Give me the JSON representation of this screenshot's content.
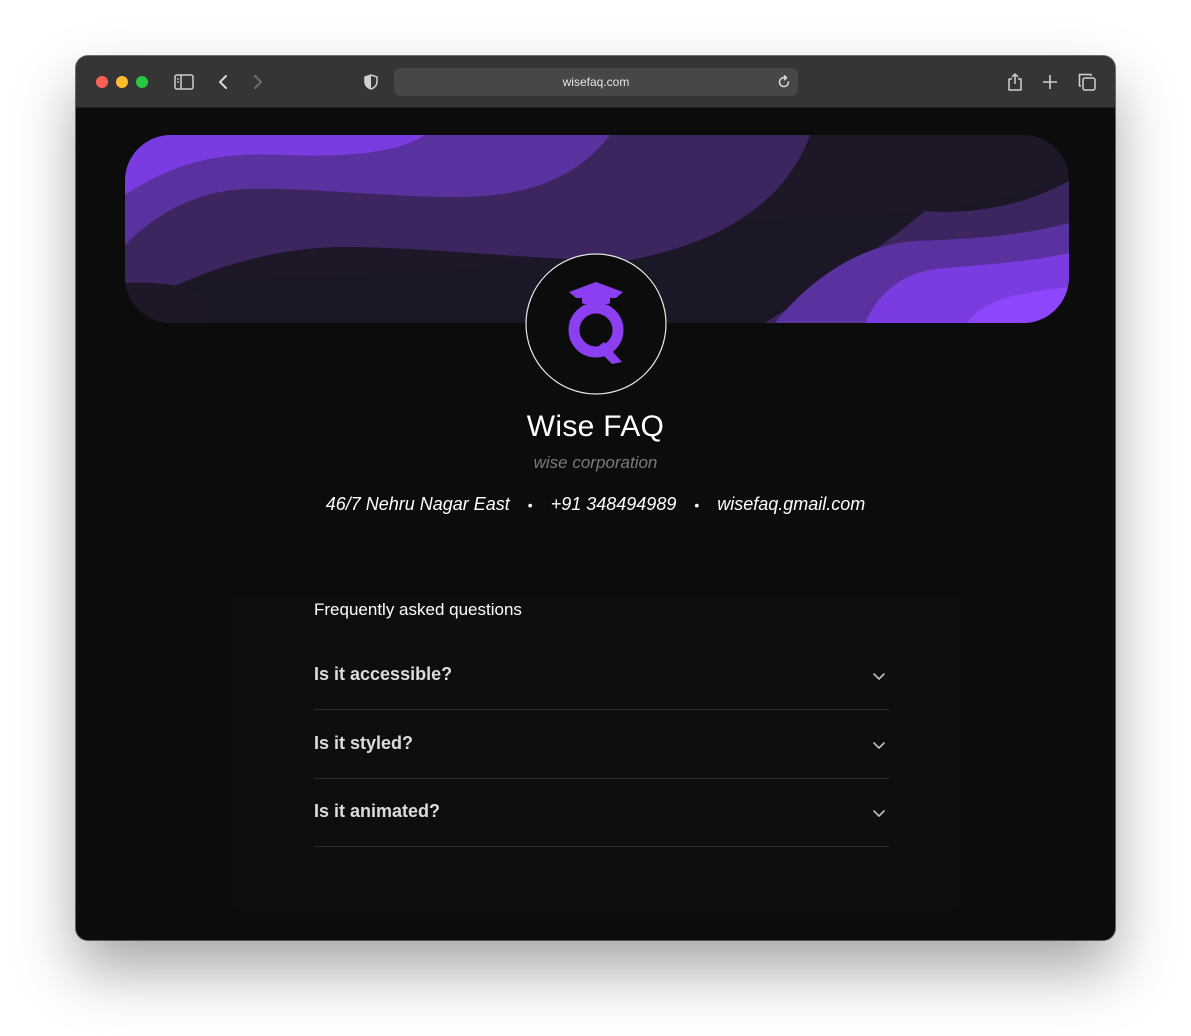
{
  "browser": {
    "url": "wisefaq.com",
    "icons": [
      "sidebar-icon",
      "back-icon",
      "forward-icon",
      "shield-icon",
      "reload-icon",
      "share-icon",
      "new-tab-icon",
      "tabs-overview-icon"
    ]
  },
  "profile": {
    "name": "Wise FAQ",
    "company": "wise corporation",
    "address": "46/7 Nehru Nagar East",
    "phone": "+91 348494989",
    "email": "wisefaq.gmail.com",
    "separator": "•"
  },
  "faq": {
    "heading": "Frequently asked questions",
    "items": [
      {
        "question": "Is it accessible?"
      },
      {
        "question": "Is it styled?"
      },
      {
        "question": "Is it animated?"
      }
    ]
  },
  "colors": {
    "accent": "#8b3ff0",
    "background": "#0c0c0c",
    "titlebar": "#353535"
  }
}
